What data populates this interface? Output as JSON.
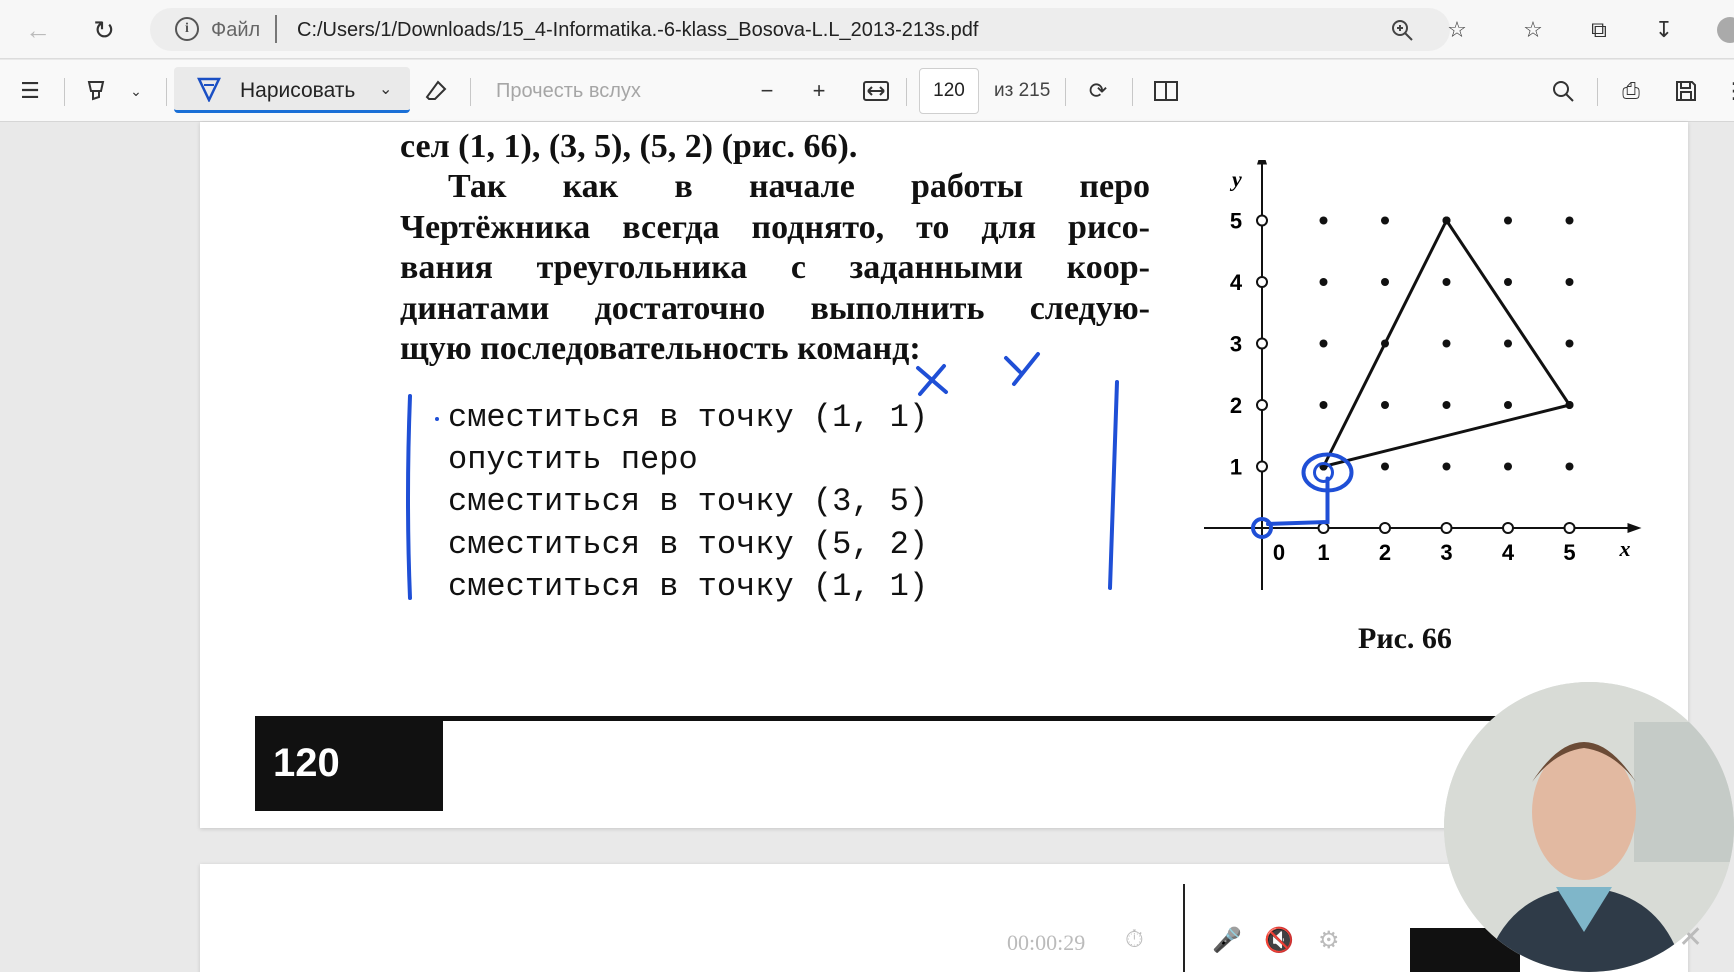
{
  "address_bar": {
    "file_label": "Файл",
    "url": "C:/Users/1/Downloads/15_4-Informatika.-6-klass_Bosova-L.L_2013-213s.pdf"
  },
  "toolbar": {
    "draw_label": "Нарисовать",
    "read_aloud": "Прочесть вслух",
    "page_current": "120",
    "page_total": "из 215"
  },
  "document": {
    "line0": "сел (1, 1), (3, 5), (5, 2) (рис. 66).",
    "para_words1": [
      "Так",
      "как",
      "в",
      "начале",
      "работы",
      "перо"
    ],
    "para_words2": [
      "Чертёжника",
      "всегда",
      "поднято,",
      "то",
      "для",
      "рисо-"
    ],
    "para_words3": [
      "вания",
      "треугольника",
      "с",
      "заданными",
      "коор-"
    ],
    "para_words4": [
      "динатами",
      "достаточно",
      "выполнить",
      "следую-"
    ],
    "para_line5": "щую последовательность команд:",
    "commands": [
      "сместиться в точку (1, 1)",
      "опустить перо",
      "сместиться в точку (3, 5)",
      "сместиться в точку (5, 2)",
      "сместиться в точку (1, 1)"
    ],
    "figure_caption": "Рис. 66",
    "page_number": "120",
    "annotations": {
      "x_mark": "X",
      "y_mark": "Y"
    }
  },
  "chart_data": {
    "type": "line",
    "xlabel": "x",
    "ylabel": "y",
    "x_ticks": [
      "0",
      "1",
      "2",
      "3",
      "4",
      "5"
    ],
    "y_ticks": [
      "1",
      "2",
      "3",
      "4",
      "5"
    ],
    "xlim": [
      0,
      5
    ],
    "ylim": [
      0,
      5
    ],
    "grid_points": true,
    "series": [
      {
        "x": [
          1,
          3,
          5,
          1
        ],
        "y": [
          1,
          5,
          2,
          1
        ]
      }
    ]
  },
  "recorder": {
    "time": "00:00:29"
  },
  "colors": {
    "ink_annotation": "#1f4fd6",
    "accent": "#1a6fd6"
  }
}
